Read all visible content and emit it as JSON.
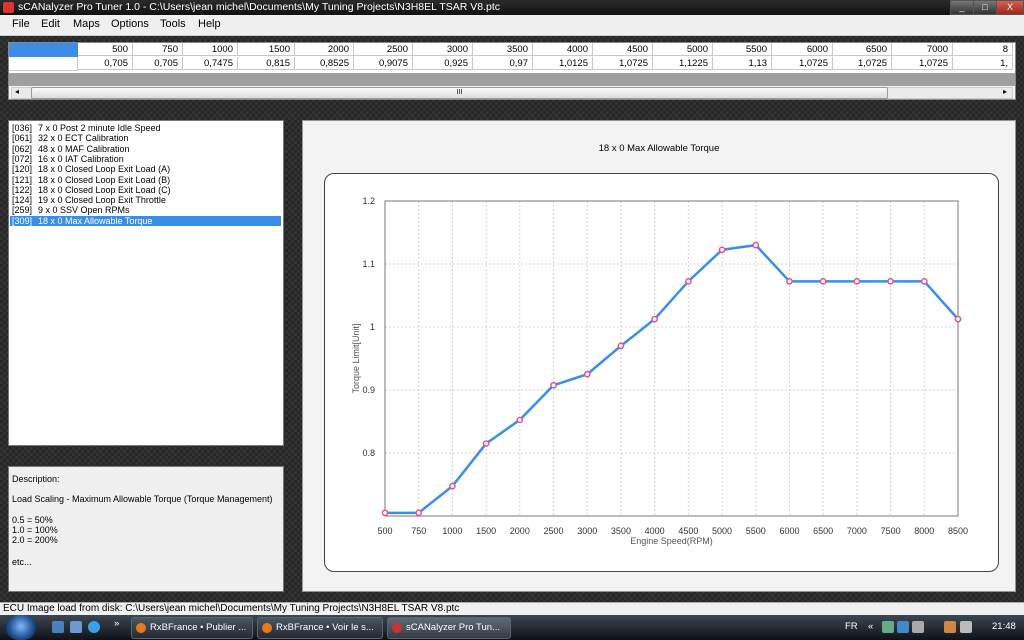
{
  "window": {
    "title": "sCANalyzer Pro Tuner 1.0 - C:\\Users\\jean michel\\Documents\\My Tuning Projects\\N3H8EL TSAR V8.ptc",
    "minimize": "_",
    "maximize": "□",
    "close": "X"
  },
  "menu": [
    "File",
    "Edit",
    "Maps",
    "Options",
    "Tools",
    "Help"
  ],
  "table": {
    "headers": [
      "500",
      "750",
      "1000",
      "1500",
      "2000",
      "2500",
      "3000",
      "3500",
      "4000",
      "4500",
      "5000",
      "5500",
      "6000",
      "6500",
      "7000",
      "8"
    ],
    "values": [
      "0,705",
      "0,705",
      "0,7475",
      "0,815",
      "0,8525",
      "0,9075",
      "0,925",
      "0,97",
      "1,0125",
      "1,0725",
      "1,1225",
      "1,13",
      "1,0725",
      "1,0725",
      "1,0725",
      "1,"
    ],
    "scroll_grip": "III",
    "scroll_left": "◂",
    "scroll_right": "▸"
  },
  "maps": [
    {
      "id": "[036]",
      "name": "7 x 0 Post 2 minute Idle Speed"
    },
    {
      "id": "[061]",
      "name": "32 x 0 ECT Calibration"
    },
    {
      "id": "[062]",
      "name": "48 x 0 MAF Calibration"
    },
    {
      "id": "[072]",
      "name": "16 x 0 IAT Calibration"
    },
    {
      "id": "[120]",
      "name": "18 x 0 Closed Loop Exit Load (A)"
    },
    {
      "id": "[121]",
      "name": "18 x 0 Closed Loop Exit Load (B)"
    },
    {
      "id": "[122]",
      "name": "18 x 0 Closed Loop Exit Load (C)"
    },
    {
      "id": "[124]",
      "name": "19 x 0 Closed Loop Exit Throttle"
    },
    {
      "id": "[259]",
      "name": "9 x 0 SSV Open RPMs"
    },
    {
      "id": "[309]",
      "name": "18 x 0 Max Allowable Torque"
    }
  ],
  "selected_map_index": 9,
  "description": {
    "heading": "Description:",
    "text": "Load Scaling - Maximum Allowable Torque (Torque Management)",
    "lines": [
      "0.5 = 50%",
      "1.0 = 100%",
      "2.0 = 200%"
    ],
    "etc": "etc..."
  },
  "chart_data": {
    "type": "line",
    "title": "18 x 0 Max Allowable Torque",
    "xlabel": "Engine Speed(RPM)",
    "ylabel": "Torque Limit[Unit]",
    "categories": [
      "500",
      "750",
      "1000",
      "1500",
      "2000",
      "2500",
      "3000",
      "3500",
      "4000",
      "4500",
      "5000",
      "5500",
      "6000",
      "6500",
      "7000",
      "7500",
      "8000",
      "8500"
    ],
    "values": [
      0.705,
      0.705,
      0.7475,
      0.815,
      0.8525,
      0.9075,
      0.925,
      0.97,
      1.0125,
      1.0725,
      1.1225,
      1.13,
      1.0725,
      1.0725,
      1.0725,
      1.0725,
      1.0725,
      1.0125
    ],
    "ylim": [
      0.7,
      1.2
    ],
    "yticks": [
      "0.8",
      "0.9",
      "1",
      "1.1",
      "1.2"
    ],
    "ytick_values": [
      0.8,
      0.9,
      1.0,
      1.1,
      1.2
    ],
    "grid": true,
    "line_color": "#3a8ee8",
    "marker_color": "#e8508a"
  },
  "status": "ECU Image load from disk: C:\\Users\\jean michel\\Documents\\My Tuning Projects\\N3H8EL TSAR V8.ptc",
  "taskbar": {
    "tasks": [
      "RxBFrance • Publier ...",
      "RxBFrance • Voir le s...",
      "sCANalyzer Pro Tun..."
    ],
    "lang": "FR",
    "time": "21:48",
    "expand": "»",
    "tray_arrow": "«"
  }
}
